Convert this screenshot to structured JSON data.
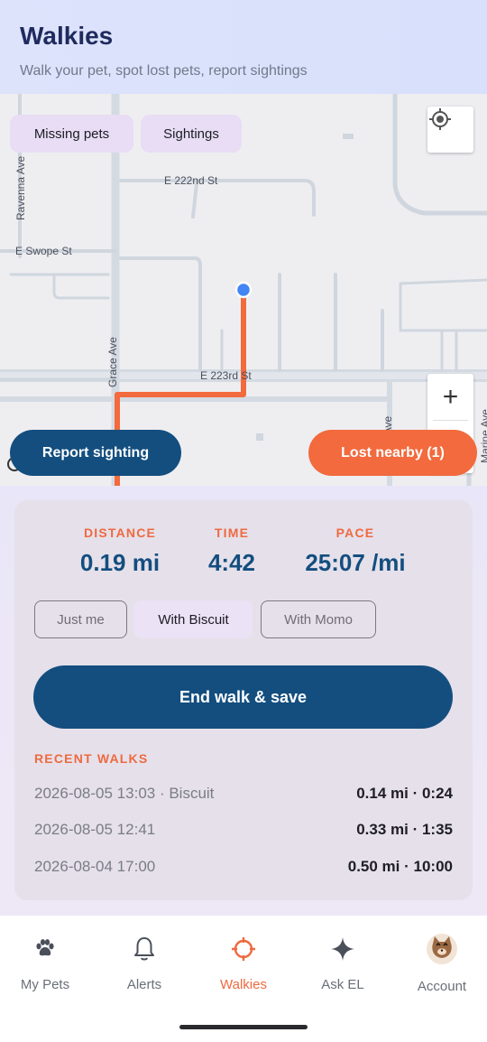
{
  "header": {
    "title": "Walkies",
    "subtitle": "Walk your pet, spot lost pets, report sightings"
  },
  "map": {
    "filters": [
      "Missing pets",
      "Sightings"
    ],
    "streets": {
      "ravenna": "Ravenna Ave",
      "e222": "E 222nd St",
      "swope": "E Swope St",
      "grace": "Grace Ave",
      "e223": "E 223rd St",
      "ave": "Ave",
      "marine": "Marine Ave"
    },
    "locate_icon": "crosshair-icon",
    "zoom_in_label": "+",
    "report_button": "Report sighting",
    "lost_button": "Lost nearby (1)",
    "route_color": "#f26a3d",
    "user_dot_color": "#4285f4"
  },
  "walk": {
    "stats": [
      {
        "label": "DISTANCE",
        "value": "0.19 mi"
      },
      {
        "label": "TIME",
        "value": "4:42"
      },
      {
        "label": "PACE",
        "value": "25:07 /mi"
      }
    ],
    "companions": [
      {
        "label": "Just me",
        "selected": false
      },
      {
        "label": "With Biscuit",
        "selected": true
      },
      {
        "label": "With Momo",
        "selected": false
      }
    ],
    "end_button": "End walk & save",
    "recent_heading": "RECENT WALKS",
    "recent": [
      {
        "date": "2026-08-05 13:03 · Biscuit",
        "stats": "0.14 mi · 0:24"
      },
      {
        "date": "2026-08-05 12:41",
        "stats": "0.33 mi · 1:35"
      },
      {
        "date": "2026-08-04 17:00",
        "stats": "0.50 mi · 10:00"
      }
    ]
  },
  "nav": {
    "items": [
      {
        "label": "My Pets",
        "icon": "paw-icon"
      },
      {
        "label": "Alerts",
        "icon": "bell-icon"
      },
      {
        "label": "Walkies",
        "icon": "crosshair-icon",
        "active": true
      },
      {
        "label": "Ask EL",
        "icon": "sparkle-icon"
      },
      {
        "label": "Account",
        "icon": "cat-avatar-icon"
      }
    ]
  },
  "colors": {
    "accent": "#ee6a40",
    "primary": "#134e7f"
  }
}
